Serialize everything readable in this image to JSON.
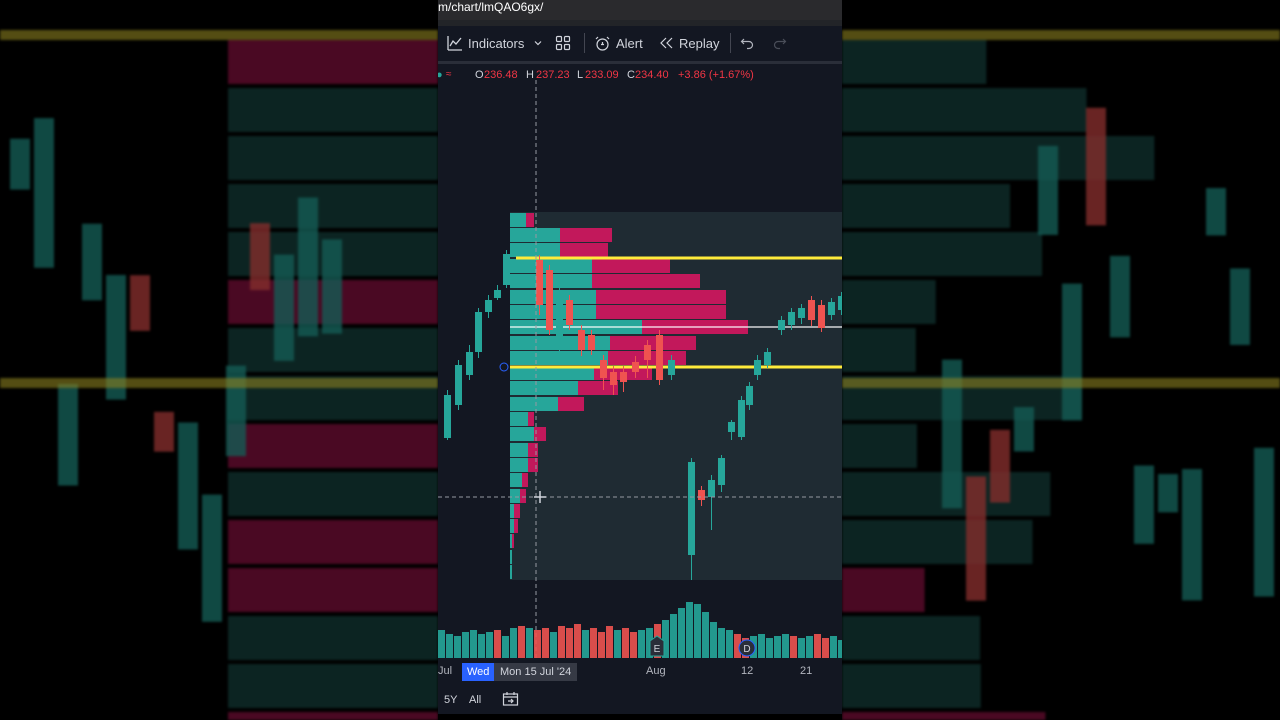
{
  "browser": {
    "url_fragment": "m/chart/lmQAO6gx/"
  },
  "toolbar": {
    "indicators_label": "Indicators",
    "alert_label": "Alert",
    "replay_label": "Replay",
    "icons": [
      "indicators-icon",
      "chevron-down-icon",
      "layout-grid-icon",
      "alarm-clock-icon",
      "replay-rewind-icon",
      "undo-icon",
      "redo-icon"
    ]
  },
  "ohlc": {
    "o_label": "O",
    "o_value": "236.48",
    "h_label": "H",
    "h_value": "237.23",
    "l_label": "L",
    "l_value": "233.09",
    "c_label": "C",
    "c_value": "234.40",
    "change": "+3.86 (+1.67%)",
    "value_color": "#f23645"
  },
  "x_axis": {
    "labels": [
      "Jul",
      "Wed",
      "Mon 15 Jul '24",
      "Aug",
      "12",
      "21"
    ]
  },
  "events": {
    "earnings_badge": "E",
    "dividend_badge": "D"
  },
  "bottom_bar": {
    "range_5y": "5Y",
    "range_all": "All"
  },
  "colors": {
    "background": "#131722",
    "bull": "#26a69a",
    "bear": "#ef5350",
    "up_volume_profile": "#26a69a",
    "down_volume_profile": "#c2185b",
    "value_area_lines": "#ffeb3b",
    "poc_line": "#ffffff",
    "crosshair_date_highlight": "#2962ff"
  }
}
